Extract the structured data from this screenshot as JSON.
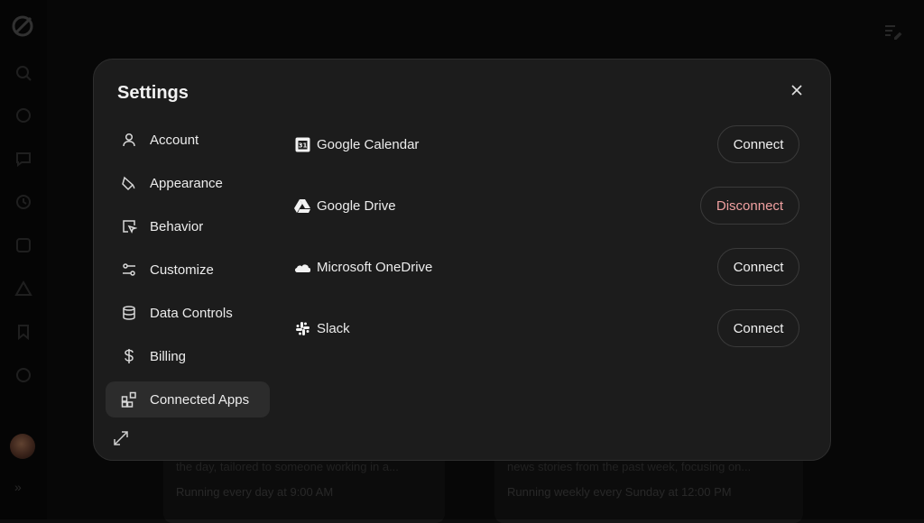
{
  "settings": {
    "title": "Settings",
    "nav": [
      {
        "label": "Account",
        "icon": "user-icon"
      },
      {
        "label": "Appearance",
        "icon": "paint-bucket-icon"
      },
      {
        "label": "Behavior",
        "icon": "cursor-box-icon"
      },
      {
        "label": "Customize",
        "icon": "sliders-icon"
      },
      {
        "label": "Data Controls",
        "icon": "database-icon"
      },
      {
        "label": "Billing",
        "icon": "dollar-icon"
      },
      {
        "label": "Connected Apps",
        "icon": "apps-grid-icon",
        "active": true
      }
    ],
    "apps": [
      {
        "name": "Google Calendar",
        "icon": "google-calendar-icon",
        "action": "Connect"
      },
      {
        "name": "Google Drive",
        "icon": "google-drive-icon",
        "action": "Disconnect"
      },
      {
        "name": "Microsoft OneDrive",
        "icon": "onedrive-icon",
        "action": "Connect"
      },
      {
        "name": "Slack",
        "icon": "slack-icon",
        "action": "Connect"
      }
    ]
  },
  "background": {
    "cards": [
      {
        "desc": "the day, tailored to someone working in a...",
        "schedule": "Running every day at 9:00 AM"
      },
      {
        "desc": "news stories from the past week, focusing on...",
        "schedule": "Running weekly every Sunday at 12:00 PM"
      }
    ],
    "expand_glyph": "»"
  },
  "colors": {
    "modal_bg": "#1c1c1c",
    "active_nav": "#2c2c2c",
    "disconnect_text": "#f0a0a0"
  }
}
